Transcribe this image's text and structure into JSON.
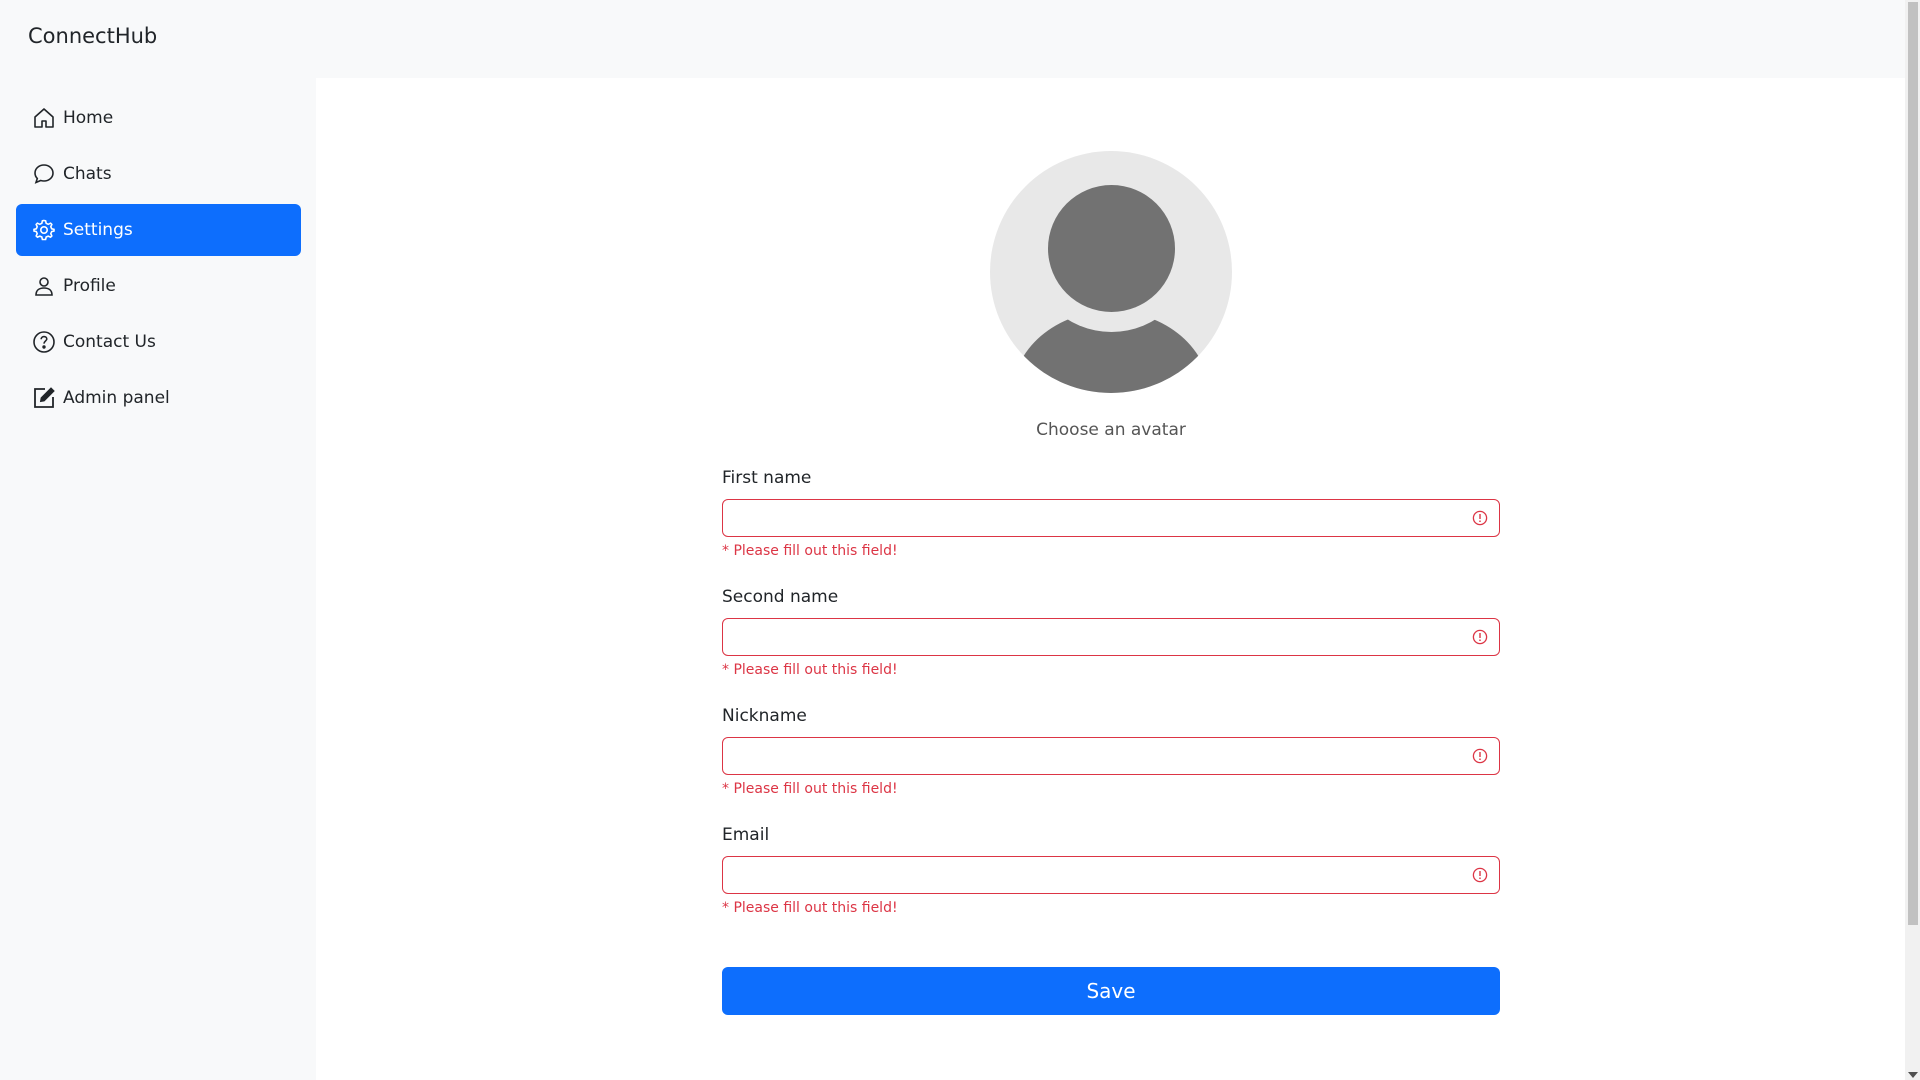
{
  "app": {
    "brand": "ConnectHub"
  },
  "sidebar": {
    "items": [
      {
        "label": "Home",
        "icon": "home-icon"
      },
      {
        "label": "Chats",
        "icon": "chat-bubble-icon"
      },
      {
        "label": "Settings",
        "icon": "gear-icon",
        "active": true
      },
      {
        "label": "Profile",
        "icon": "person-icon"
      },
      {
        "label": "Contact Us",
        "icon": "question-circle-icon"
      },
      {
        "label": "Admin panel",
        "icon": "edit-square-icon"
      }
    ]
  },
  "form": {
    "avatar_label": "Choose an avatar",
    "fields": [
      {
        "label": "First name",
        "value": "",
        "placeholder": "",
        "error": "* Please fill out this field!"
      },
      {
        "label": "Second name",
        "value": "",
        "placeholder": "",
        "error": "* Please fill out this field!"
      },
      {
        "label": "Nickname",
        "value": "",
        "placeholder": "",
        "error": "* Please fill out this field!"
      },
      {
        "label": "Email",
        "value": "",
        "placeholder": "",
        "error": "* Please fill out this field!"
      }
    ],
    "save_label": "Save"
  },
  "colors": {
    "accent": "#0d6efd",
    "error": "#dc3545",
    "sidebar_bg": "#f8f9fa",
    "main_bg": "#ffffff"
  }
}
